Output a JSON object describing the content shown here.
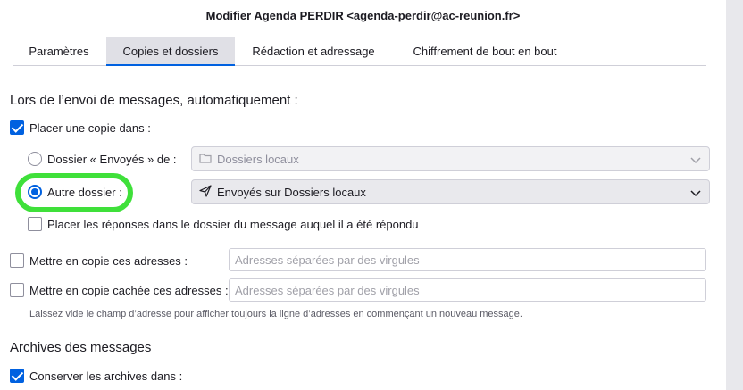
{
  "window": {
    "title": "Modifier Agenda PERDIR <agenda-perdir@ac-reunion.fr>"
  },
  "tabs": [
    {
      "label": "Paramètres",
      "selected": false
    },
    {
      "label": "Copies et dossiers",
      "selected": true
    },
    {
      "label": "Rédaction et adressage",
      "selected": false
    },
    {
      "label": "Chiffrement de bout en bout",
      "selected": false
    }
  ],
  "send_section": {
    "heading": "Lors de l’envoi de messages, automatiquement :",
    "place_copy": {
      "label": "Placer une copie dans :",
      "checked": true
    },
    "sent_folder_option": {
      "label": "Dossier « Envoyés » de :",
      "selected": false,
      "select_value": "Dossiers locaux",
      "icon": "folder-icon"
    },
    "other_folder_option": {
      "label": "Autre dossier :",
      "selected": true,
      "select_value": "Envoyés sur Dossiers locaux",
      "icon": "send-icon"
    },
    "replies_in_folder": {
      "label": "Placer les réponses dans le dossier du message auquel il a été répondu",
      "checked": false
    },
    "cc": {
      "label": "Mettre en copie ces adresses :",
      "checked": false,
      "placeholder": "Adresses séparées par des virgules"
    },
    "bcc": {
      "label": "Mettre en copie cachée ces adresses :",
      "checked": false,
      "placeholder": "Adresses séparées par des virgules"
    },
    "hint": "Laissez vide le champ d’adresse pour afficher toujours la ligne d’adresses en commençant un nouveau message."
  },
  "archive_section": {
    "heading": "Archives des messages",
    "keep_archives": {
      "label": "Conserver les archives dans :",
      "checked": true
    }
  },
  "colors": {
    "accent": "#0061e0",
    "highlight": "#3fe03a"
  }
}
